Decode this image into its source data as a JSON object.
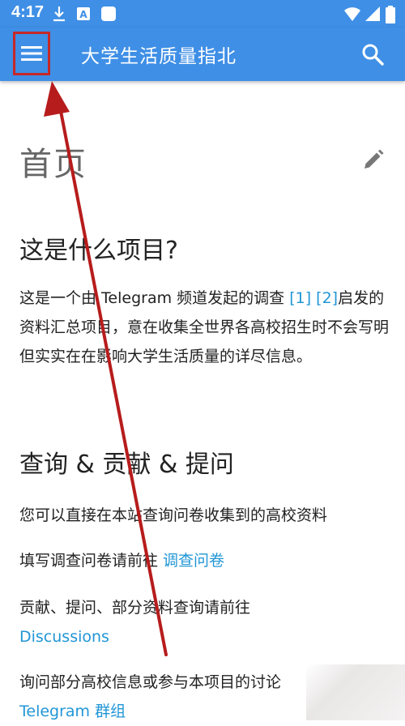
{
  "status_bar": {
    "time": "4:17",
    "icons": [
      "download-icon",
      "a-badge-icon",
      "square-icon",
      "wifi-icon",
      "signal-icon",
      "battery-icon"
    ]
  },
  "app_bar": {
    "title": "大学生活质量指北",
    "menu_icon": "hamburger-menu-icon",
    "search_icon": "search-icon"
  },
  "page": {
    "title": "首页",
    "edit_icon": "pencil-icon",
    "section1": {
      "heading": "这是什么项目?",
      "text_a": "这是一个由 Telegram 频道发起的调查 ",
      "ref1": "[1]",
      "ref2": "[2]",
      "text_b": "启发的资料汇总项目，意在收集全世界各高校招生时不会写明但实实在在影响大学生活质量的详尽信息。"
    },
    "section2": {
      "heading": "查询 & 贡献 & 提问",
      "p1": "您可以直接在本站查询问卷收集到的高校资料",
      "p2_text": "填写调查问卷请前往 ",
      "p2_link": "调查问卷",
      "p3_text": "贡献、提问、部分资料查询请前往",
      "p3_link": "Discussions",
      "p4_text": "询问部分高校信息或参与本项目的讨论",
      "p4_link": "Telegram 群组"
    }
  },
  "colors": {
    "app_bar": "#3f8fe6",
    "link": "#2196d6",
    "highlight_box": "#c62828",
    "arrow": "#b71c1c"
  }
}
